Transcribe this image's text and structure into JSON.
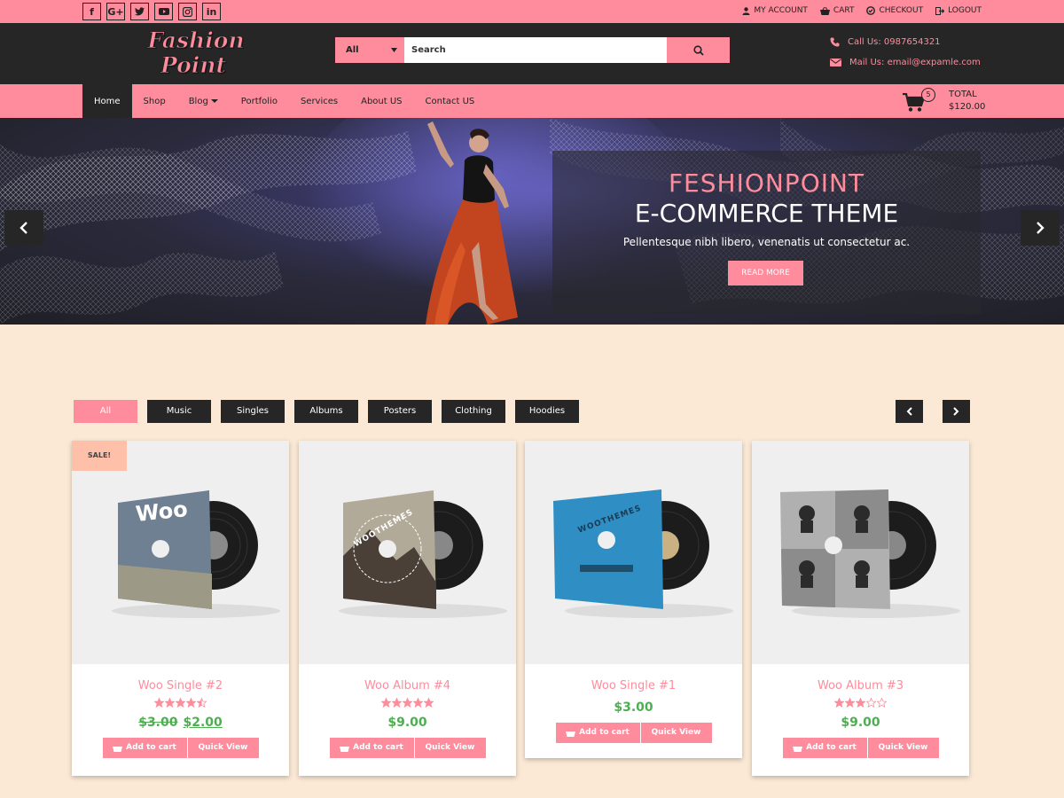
{
  "topbar": {
    "social": [
      "f",
      "G+",
      "t",
      "yt",
      "ig",
      "in"
    ],
    "links": [
      {
        "icon": "user-icon",
        "label": "MY ACCOUNT"
      },
      {
        "icon": "cart-icon",
        "label": "CART"
      },
      {
        "icon": "checkout-icon",
        "label": "CHECKOUT"
      },
      {
        "icon": "logout-icon",
        "label": "LOGOUT"
      }
    ]
  },
  "header": {
    "logo_line1": "Fashion",
    "logo_line2": "Point",
    "search_category": "All",
    "search_placeholder": "Search",
    "phone": "Call Us: 0987654321",
    "email": "Mail Us: email@expamle.com"
  },
  "nav": {
    "items": [
      "Home",
      "Shop",
      "Blog",
      "Portfolio",
      "Services",
      "About US",
      "Contact US"
    ],
    "cart_count": "5",
    "total_label": "TOTAL",
    "total_value": "$120.00"
  },
  "slider": {
    "title1": "FESHIONPOINT",
    "title2": "E-COMMERCE THEME",
    "text": "Pellentesque nibh libero, venenatis ut consectetur ac.",
    "button": "READ MORE"
  },
  "filters": [
    "All",
    "Music",
    "Singles",
    "Albums",
    "Posters",
    "Clothing",
    "Hoodies"
  ],
  "products": [
    {
      "name": "Woo Single #2",
      "rating": 4.5,
      "old_price": "$3.00",
      "price": "$2.00",
      "sale": "SALE!",
      "cover_text": "Woo",
      "add_to_cart": "Add to cart",
      "quick_view": "Quick View"
    },
    {
      "name": "Woo Album #4",
      "rating": 5,
      "old_price": "",
      "price": "$9.00",
      "sale": "",
      "cover_text": "WOOTHEMES",
      "add_to_cart": "Add to cart",
      "quick_view": "Quick View"
    },
    {
      "name": "Woo Single #1",
      "rating": 0,
      "old_price": "",
      "price": "$3.00",
      "sale": "",
      "cover_text": "WOOTHEMES",
      "add_to_cart": "Add to cart",
      "quick_view": "Quick View"
    },
    {
      "name": "Woo Album #3",
      "rating": 3,
      "old_price": "",
      "price": "$9.00",
      "sale": "",
      "cover_text": "",
      "add_to_cart": "Add to cart",
      "quick_view": "Quick View"
    }
  ],
  "colors": {
    "accent": "#fe8c9c",
    "dark": "#262626",
    "page_bg": "#fbe9d5",
    "price": "#4caf50"
  }
}
